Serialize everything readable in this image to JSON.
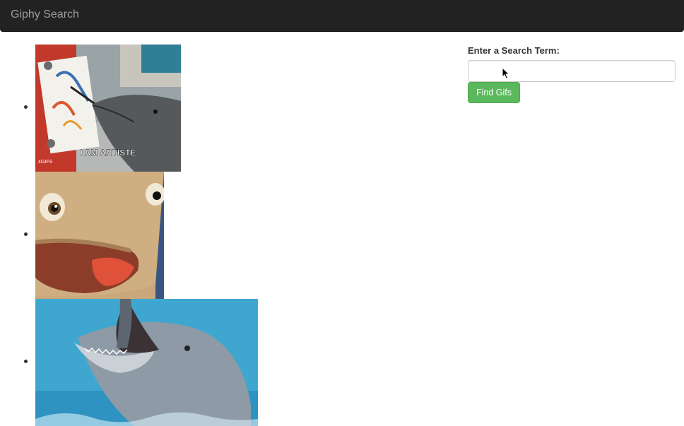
{
  "navbar": {
    "brand": "Giphy Search"
  },
  "gifs": [
    {
      "caption": "I AM ARTISTE",
      "watermark": "4GIFS",
      "subject": "dolphin painting on easel"
    },
    {
      "subject": "cartoon dolphin face"
    },
    {
      "subject": "dolphin open mouth in water"
    }
  ],
  "search": {
    "label": "Enter a Search Term:",
    "value": "",
    "placeholder": "",
    "button_label": "Find Gifs"
  },
  "colors": {
    "navbar_bg": "#222222",
    "brand_text": "#9d9d9d",
    "button_bg": "#5cb85c",
    "input_border": "#cccccc"
  }
}
